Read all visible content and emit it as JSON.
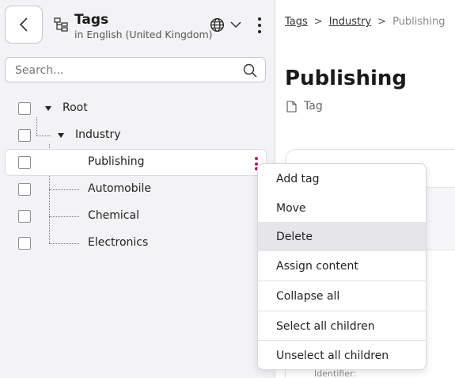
{
  "header": {
    "title": "Tags",
    "subtitle": "in English (United Kingdom)"
  },
  "search": {
    "placeholder": "Search..."
  },
  "tree": {
    "root": "Root",
    "industry": "Industry",
    "children": [
      "Publishing",
      "Automobile",
      "Chemical",
      "Electronics"
    ]
  },
  "breadcrumb": {
    "items": [
      "Tags",
      "Industry",
      "Publishing"
    ],
    "separator": ">"
  },
  "detail": {
    "title": "Publishing",
    "type": "Tag",
    "identifier_label": "Identifier:"
  },
  "context_menu": {
    "items": [
      "Add tag",
      "Move",
      "Delete",
      "Assign content",
      "Collapse all",
      "Select all children",
      "Unselect all children"
    ],
    "highlighted": "Delete"
  },
  "colors": {
    "accent": "#b0186f",
    "panel_bg": "#f3f3f5",
    "highlight": "#e6e6ea"
  }
}
